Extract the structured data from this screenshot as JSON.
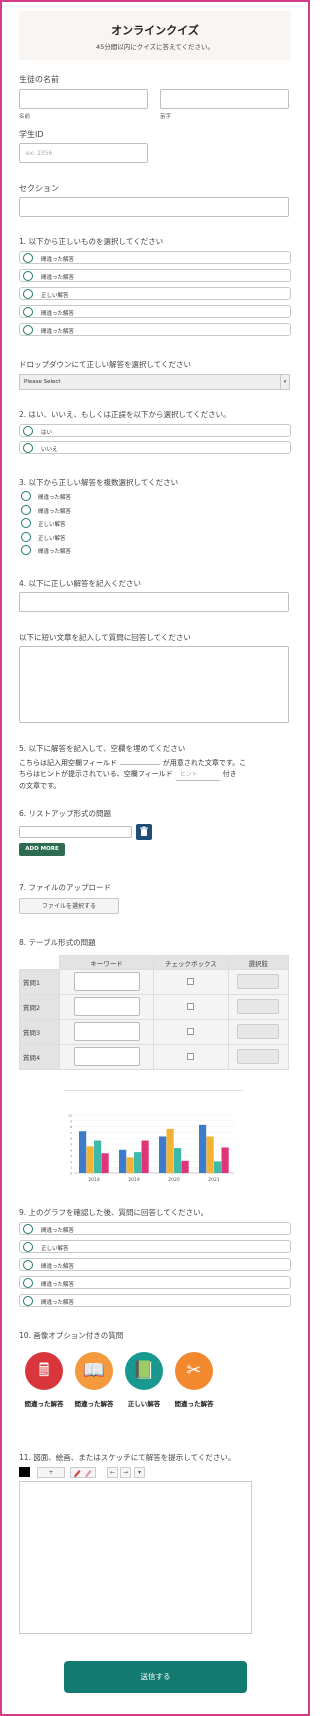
{
  "header": {
    "title": "オンラインクイズ",
    "subtitle": "45分間以内にクイズに答えてください。"
  },
  "student_name": {
    "label": "生徒の名前",
    "first_caption": "名前",
    "last_caption": "苗字"
  },
  "student_id": {
    "label": "学生ID",
    "placeholder": "ex: 2356"
  },
  "section": {
    "label": "セクション"
  },
  "q1": {
    "label": "1. 以下から正しいものを選択してください",
    "options": [
      "間違った解答",
      "間違った解答",
      "正しい解答",
      "間違った解答",
      "間違った解答"
    ]
  },
  "dropdown": {
    "label": "ドロップダウンにて正しい解答を選択してください",
    "selected": "Please Select",
    "arrow": "▾"
  },
  "q2": {
    "label": "2. はい、いいえ、もしくは正誤を以下から選択してください。",
    "options": [
      "はい",
      "いいえ"
    ]
  },
  "q3": {
    "label": "3. 以下から正しい解答を複数選択してください",
    "options": [
      "間違った解答",
      "間違った解答",
      "正しい解答",
      "正しい解答",
      "間違った解答"
    ]
  },
  "q4": {
    "label": "4. 以下に正しい解答を記入ください"
  },
  "short_text": {
    "label": "以下に短い文章を記入して質問に回答してください"
  },
  "q5": {
    "label": "5. 以下に解答を記入して、空欄を埋めてください",
    "line1a": "こちらは記入用空欄フィールド",
    "line1b": "が用意された文章です。こ",
    "line2a": "ちらはヒントが提示されている、空欄フィールド",
    "hint_placeholder": "ヒント",
    "line2b": "付き",
    "line3": "の文章です。"
  },
  "q6": {
    "label": "6. リストアップ形式の問題",
    "add_more": "ADD MORE"
  },
  "q7": {
    "label": "7. ファイルのアップロード",
    "button": "ファイルを選択する"
  },
  "q8": {
    "label": "8. テーブル形式の問題",
    "columns": [
      "キーワード",
      "チェックボックス",
      "選択肢"
    ],
    "rows": [
      "質問1",
      "質問2",
      "質問3",
      "質問4"
    ]
  },
  "chart_data": {
    "type": "bar",
    "categories": [
      "2018",
      "2019",
      "2020",
      "2021"
    ],
    "ylim": [
      0,
      10
    ],
    "yticks": [
      "0",
      "1",
      "2",
      "3",
      "4",
      "5",
      "6",
      "7",
      "8",
      "9",
      "10"
    ],
    "series": [
      {
        "values": [
          7.2,
          4.0,
          6.3,
          8.3
        ],
        "color": "#3d7cc9"
      },
      {
        "values": [
          4.6,
          2.7,
          7.6,
          6.3
        ],
        "color": "#f2b233"
      },
      {
        "values": [
          5.6,
          3.6,
          4.3,
          2.0
        ],
        "color": "#3fb9a8"
      },
      {
        "values": [
          3.4,
          5.6,
          2.1,
          4.4
        ],
        "color": "#e0347a"
      }
    ]
  },
  "q9": {
    "label": "9. 上のグラフを確認した後、質問に回答してください。",
    "options": [
      "間違った解答",
      "正しい解答",
      "間違った解答",
      "間違った解答",
      "間違った解答"
    ]
  },
  "q10": {
    "label": "10. 画像オプション付きの質問",
    "options": [
      {
        "label": "間違った解答",
        "icon": "calculator-icon",
        "color": "#d9353c"
      },
      {
        "label": "間違った解答",
        "icon": "book-icon",
        "color": "#f39a3c"
      },
      {
        "label": "正しい解答",
        "icon": "notebook-icon",
        "color": "#17998f"
      },
      {
        "label": "間違った解答",
        "icon": "scissors-icon",
        "color": "#f3892f"
      }
    ]
  },
  "q11": {
    "label": "11. 図面、絵画、またはスケッチにて解答を提示してください。",
    "tools": [
      "+",
      "←",
      "→",
      "▾"
    ]
  },
  "submit": {
    "label": "送信する"
  },
  "colors": {
    "accent": "#127a70",
    "border": "#d63b8a",
    "radio": "#1f7a72"
  }
}
